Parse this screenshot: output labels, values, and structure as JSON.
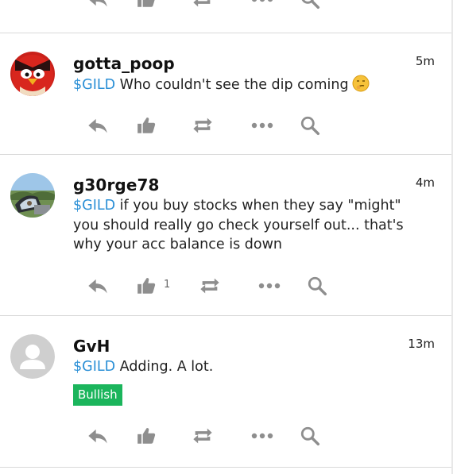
{
  "colors": {
    "ticker": "#2a8fd6",
    "icon": "#8e8e8e",
    "bullish_bg": "#1bb55c"
  },
  "posts": [
    {
      "username": "gotta_poop",
      "time": "5m",
      "ticker": "$GILD",
      "text": " Who couldn't see the dip coming",
      "emoji": "smirk-emoji",
      "likes": ""
    },
    {
      "username": "g30rge78",
      "time": "4m",
      "ticker": "$GILD",
      "text": " if you buy stocks when they say \"might\" you should really go check yourself out... that's why your acc balance is down",
      "likes": "1"
    },
    {
      "username": "GvH",
      "time": "13m",
      "ticker": "$GILD",
      "text": " Adding. A lot.",
      "sentiment": "Bullish",
      "likes": ""
    }
  ],
  "actions": {
    "reply": "reply-icon",
    "like": "like-icon",
    "reshare": "reshare-icon",
    "more": "more-icon",
    "search": "search-icon"
  }
}
